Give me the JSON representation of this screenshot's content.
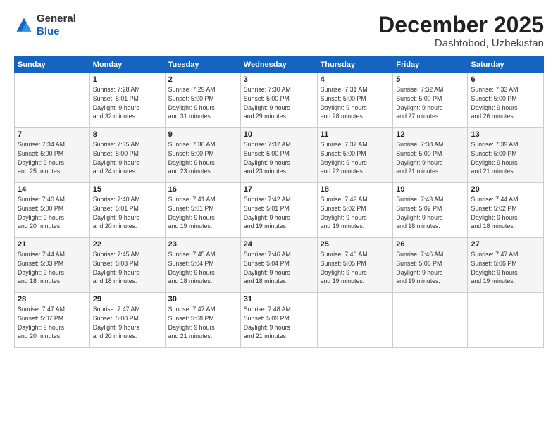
{
  "logo": {
    "general": "General",
    "blue": "Blue"
  },
  "header": {
    "month_year": "December 2025",
    "location": "Dashtobod, Uzbekistan"
  },
  "days_of_week": [
    "Sunday",
    "Monday",
    "Tuesday",
    "Wednesday",
    "Thursday",
    "Friday",
    "Saturday"
  ],
  "weeks": [
    [
      {
        "day": "",
        "info": ""
      },
      {
        "day": "1",
        "info": "Sunrise: 7:28 AM\nSunset: 5:01 PM\nDaylight: 9 hours\nand 32 minutes."
      },
      {
        "day": "2",
        "info": "Sunrise: 7:29 AM\nSunset: 5:00 PM\nDaylight: 9 hours\nand 31 minutes."
      },
      {
        "day": "3",
        "info": "Sunrise: 7:30 AM\nSunset: 5:00 PM\nDaylight: 9 hours\nand 29 minutes."
      },
      {
        "day": "4",
        "info": "Sunrise: 7:31 AM\nSunset: 5:00 PM\nDaylight: 9 hours\nand 28 minutes."
      },
      {
        "day": "5",
        "info": "Sunrise: 7:32 AM\nSunset: 5:00 PM\nDaylight: 9 hours\nand 27 minutes."
      },
      {
        "day": "6",
        "info": "Sunrise: 7:33 AM\nSunset: 5:00 PM\nDaylight: 9 hours\nand 26 minutes."
      }
    ],
    [
      {
        "day": "7",
        "info": "Sunrise: 7:34 AM\nSunset: 5:00 PM\nDaylight: 9 hours\nand 25 minutes."
      },
      {
        "day": "8",
        "info": "Sunrise: 7:35 AM\nSunset: 5:00 PM\nDaylight: 9 hours\nand 24 minutes."
      },
      {
        "day": "9",
        "info": "Sunrise: 7:36 AM\nSunset: 5:00 PM\nDaylight: 9 hours\nand 23 minutes."
      },
      {
        "day": "10",
        "info": "Sunrise: 7:37 AM\nSunset: 5:00 PM\nDaylight: 9 hours\nand 23 minutes."
      },
      {
        "day": "11",
        "info": "Sunrise: 7:37 AM\nSunset: 5:00 PM\nDaylight: 9 hours\nand 22 minutes."
      },
      {
        "day": "12",
        "info": "Sunrise: 7:38 AM\nSunset: 5:00 PM\nDaylight: 9 hours\nand 21 minutes."
      },
      {
        "day": "13",
        "info": "Sunrise: 7:39 AM\nSunset: 5:00 PM\nDaylight: 9 hours\nand 21 minutes."
      }
    ],
    [
      {
        "day": "14",
        "info": "Sunrise: 7:40 AM\nSunset: 5:00 PM\nDaylight: 9 hours\nand 20 minutes."
      },
      {
        "day": "15",
        "info": "Sunrise: 7:40 AM\nSunset: 5:01 PM\nDaylight: 9 hours\nand 20 minutes."
      },
      {
        "day": "16",
        "info": "Sunrise: 7:41 AM\nSunset: 5:01 PM\nDaylight: 9 hours\nand 19 minutes."
      },
      {
        "day": "17",
        "info": "Sunrise: 7:42 AM\nSunset: 5:01 PM\nDaylight: 9 hours\nand 19 minutes."
      },
      {
        "day": "18",
        "info": "Sunrise: 7:42 AM\nSunset: 5:02 PM\nDaylight: 9 hours\nand 19 minutes."
      },
      {
        "day": "19",
        "info": "Sunrise: 7:43 AM\nSunset: 5:02 PM\nDaylight: 9 hours\nand 18 minutes."
      },
      {
        "day": "20",
        "info": "Sunrise: 7:44 AM\nSunset: 5:02 PM\nDaylight: 9 hours\nand 18 minutes."
      }
    ],
    [
      {
        "day": "21",
        "info": "Sunrise: 7:44 AM\nSunset: 5:03 PM\nDaylight: 9 hours\nand 18 minutes."
      },
      {
        "day": "22",
        "info": "Sunrise: 7:45 AM\nSunset: 5:03 PM\nDaylight: 9 hours\nand 18 minutes."
      },
      {
        "day": "23",
        "info": "Sunrise: 7:45 AM\nSunset: 5:04 PM\nDaylight: 9 hours\nand 18 minutes."
      },
      {
        "day": "24",
        "info": "Sunrise: 7:46 AM\nSunset: 5:04 PM\nDaylight: 9 hours\nand 18 minutes."
      },
      {
        "day": "25",
        "info": "Sunrise: 7:46 AM\nSunset: 5:05 PM\nDaylight: 9 hours\nand 19 minutes."
      },
      {
        "day": "26",
        "info": "Sunrise: 7:46 AM\nSunset: 5:06 PM\nDaylight: 9 hours\nand 19 minutes."
      },
      {
        "day": "27",
        "info": "Sunrise: 7:47 AM\nSunset: 5:06 PM\nDaylight: 9 hours\nand 19 minutes."
      }
    ],
    [
      {
        "day": "28",
        "info": "Sunrise: 7:47 AM\nSunset: 5:07 PM\nDaylight: 9 hours\nand 20 minutes."
      },
      {
        "day": "29",
        "info": "Sunrise: 7:47 AM\nSunset: 5:08 PM\nDaylight: 9 hours\nand 20 minutes."
      },
      {
        "day": "30",
        "info": "Sunrise: 7:47 AM\nSunset: 5:08 PM\nDaylight: 9 hours\nand 21 minutes."
      },
      {
        "day": "31",
        "info": "Sunrise: 7:48 AM\nSunset: 5:09 PM\nDaylight: 9 hours\nand 21 minutes."
      },
      {
        "day": "",
        "info": ""
      },
      {
        "day": "",
        "info": ""
      },
      {
        "day": "",
        "info": ""
      }
    ]
  ]
}
